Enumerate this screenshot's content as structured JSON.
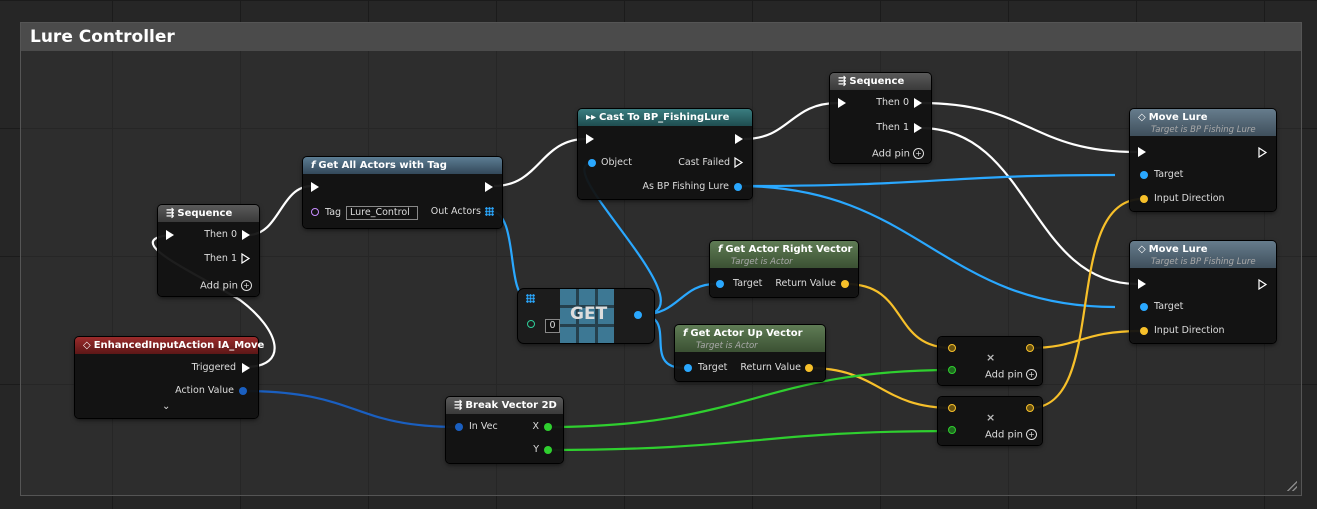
{
  "comment": {
    "title": "Lure Controller"
  },
  "nodes": {
    "sequence_left": {
      "title": "Sequence",
      "then0": "Then 0",
      "then1": "Then 1",
      "add_pin": "Add pin"
    },
    "get_all_actors": {
      "title": "Get All Actors with Tag",
      "tag_label": "Tag",
      "tag_value": "Lure_Control",
      "out_actors": "Out Actors"
    },
    "cast": {
      "title": "Cast To BP_FishingLure",
      "object": "Object",
      "cast_failed": "Cast Failed",
      "as_bp": "As BP Fishing Lure"
    },
    "sequence_top": {
      "title": "Sequence",
      "then0": "Then 0",
      "then1": "Then 1",
      "add_pin": "Add pin"
    },
    "move_lure_1": {
      "title": "Move Lure",
      "subtitle": "Target is BP Fishing Lure",
      "target": "Target",
      "input_direction": "Input Direction"
    },
    "move_lure_2": {
      "title": "Move Lure",
      "subtitle": "Target is BP Fishing Lure",
      "target": "Target",
      "input_direction": "Input Direction"
    },
    "get": {
      "label": "GET",
      "index": "0"
    },
    "right_vector": {
      "title": "Get Actor Right Vector",
      "subtitle": "Target is Actor",
      "target": "Target",
      "return_value": "Return Value"
    },
    "up_vector": {
      "title": "Get Actor Up Vector",
      "subtitle": "Target is Actor",
      "target": "Target",
      "return_value": "Return Value"
    },
    "input_action": {
      "title": "EnhancedInputAction IA_Move",
      "triggered": "Triggered",
      "action_value": "Action Value"
    },
    "break_vector": {
      "title": "Break Vector 2D",
      "in_vec": "In Vec",
      "x": "X",
      "y": "Y"
    },
    "multiply_1": {
      "add_pin": "Add pin",
      "symbol": "×"
    },
    "multiply_2": {
      "add_pin": "Add pin",
      "symbol": "×"
    }
  },
  "colors": {
    "exec": "#ffffff",
    "object": "#2aa8ff",
    "vector2d": "#1a5fc0",
    "vector": "#f7c02a",
    "float": "#2fcf2f",
    "name": "#c88dff"
  }
}
